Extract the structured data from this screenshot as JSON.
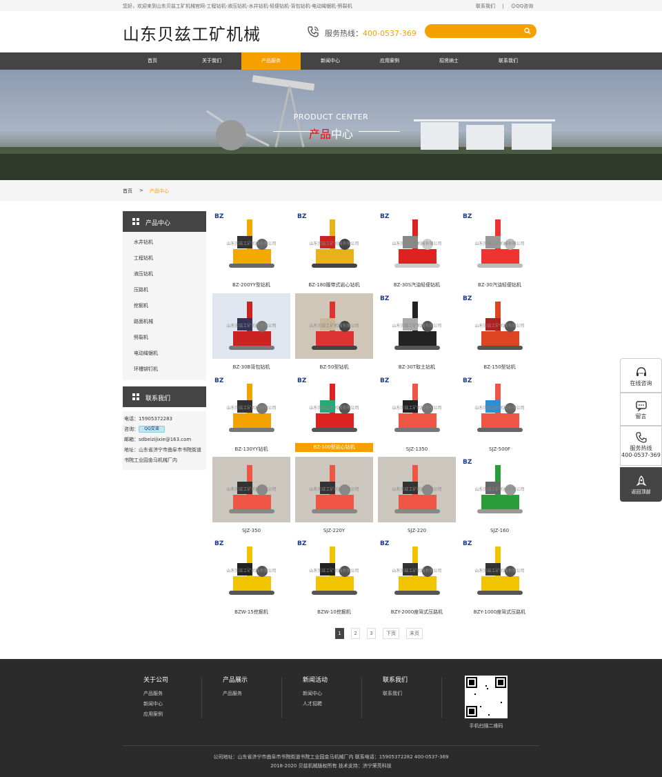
{
  "topbar": {
    "welcome": "您好，欢迎来到山东贝兹工矿机械官网-工程钻机-液压钻机-水井钻机-轻便钻机-背包钻机-电动绳锯机-劈裂机",
    "contact": "联系我们",
    "qq": "QQ咨询"
  },
  "header": {
    "logo": "山东贝兹工矿机械",
    "hotline_label": "服务热线：",
    "hotline": "400-0537-369",
    "search_placeholder": ""
  },
  "nav": [
    "首页",
    "关于我们",
    "产品服务",
    "新闻中心",
    "应用案例",
    "招贤纳士",
    "联系我们"
  ],
  "nav_active": 2,
  "banner": {
    "en": "PRODUCT CENTER",
    "cn_hl": "产品",
    "cn": "中心"
  },
  "breadcrumb": {
    "home": "首页",
    "sep": ">",
    "current": "产品中心"
  },
  "sidebar": {
    "title": "产品中心",
    "items": [
      "水井钻机",
      "工程钻机",
      "液压钻机",
      "压路机",
      "挖掘机",
      "路面机械",
      "劈裂机",
      "电动绳锯机",
      "环槽铆钉机"
    ],
    "contact_title": "联系我们",
    "phone_label": "电话：",
    "phone": "15905372283",
    "qq_label": "咨询：",
    "qq_btn": "QQ交谈",
    "email_label": "邮箱：",
    "email": "sdbeizijixie@163.com",
    "addr_label": "地址：",
    "addr1": "山东省济宁市曲阜市书院街道",
    "addr2": "书院工业园金马机械厂内"
  },
  "watermark": "山东贝兹工矿机械有限公司",
  "products": [
    "BZ-200YY型钻机",
    "BZ-180履带式岩心钻机",
    "BZ-30S汽油轻便钻机",
    "BZ-30汽油轻便钻机",
    "BZ-30B背包钻机",
    "BZ-50型钻机",
    "BZ-30T取土钻机",
    "BZ-150型钻机",
    "BZ-130YY钻机",
    "BZ-100型岩心钻机",
    "SJZ-1350",
    "SJZ-500F",
    "SJZ-350",
    "SJZ-220Y",
    "SJZ-220",
    "SJZ-160",
    "BZW-15挖掘机",
    "BZW-10挖掘机",
    "BZY-2000座驾式压路机",
    "BZY-1000座驾式压路机"
  ],
  "selected_product": 9,
  "pager": {
    "pages": [
      "1",
      "2",
      "3"
    ],
    "next": "下页",
    "last": "末页",
    "current": 0
  },
  "footer": {
    "cols": [
      {
        "title": "关于公司",
        "links": [
          "产品服务",
          "新闻中心",
          "应用案例"
        ]
      },
      {
        "title": "产品展示",
        "links": [
          "产品服务"
        ]
      },
      {
        "title": "新闻活动",
        "links": [
          "新闻中心",
          "人才招聘"
        ]
      },
      {
        "title": "联系我们",
        "links": [
          "联系我们"
        ]
      }
    ],
    "qr_caption": "手机扫描二维码",
    "line1": "公司地址：山东省济宁市曲阜市书院街道书院工业园金马机械厂内    联系电话：15905372282  400-0537-369",
    "line2": "2018-2020 贝兹机械版权所有  技术支持：济宁荣亮科技"
  },
  "float": {
    "chat": "在线咨询",
    "msg": "留言",
    "hot_label": "服务热线",
    "hot": "400-0537-369",
    "top": "返回顶部"
  }
}
